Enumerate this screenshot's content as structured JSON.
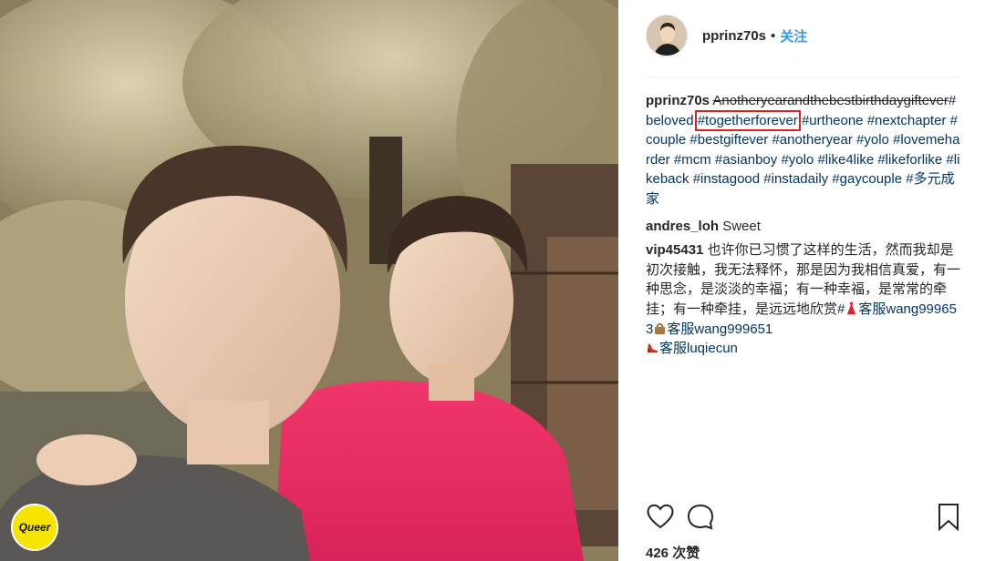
{
  "photo": {
    "badge": "Queer"
  },
  "post": {
    "author": "pprinz70s",
    "separator": "•",
    "follow_label": "关注"
  },
  "caption": {
    "username": "pprinz70s",
    "struck_text": "Anotheryearandthebestbirthdaygiftever",
    "tags": [
      "#beloved",
      "#togetherforever",
      "#urtheone",
      "#nextchapter",
      "#couple",
      "#bestgiftever",
      "#anotheryear",
      "#yolo",
      "#lovemeharder",
      "#mcm",
      "#asianboy",
      "#yolo",
      "#like4like",
      "#likeforlike",
      "#likeback",
      "#instagood",
      "#instadaily",
      "#gaycouple",
      "#多元成家"
    ]
  },
  "comments": [
    {
      "username": "andres_loh",
      "text": "Sweet"
    },
    {
      "username": "vip45431",
      "text": "也许你已习惯了这样的生活，然而我却是初次接触，我无法释怀，那是因为我相信真爱，有一种思念，是淡淡的幸福；有一种幸福，是常常的牵挂；有一种牵挂，是远远地欣赏",
      "tag_prefix": "#",
      "spam_1": "客服wang999653",
      "spam_2": "客服wang999651",
      "spam_3": "客服luqiecun",
      "emoji_1": "dress-emoji",
      "emoji_2": "handbag-emoji",
      "emoji_3": "high-heel-emoji"
    }
  ],
  "actions": {
    "icons": [
      "heart-icon",
      "comment-icon",
      "bookmark-icon"
    ]
  },
  "likes": "426 次赞",
  "colors": {
    "hashtag": "#003569",
    "follow": "#3897f0",
    "highlight_box": "#e02020",
    "badge": "#f5e300"
  }
}
